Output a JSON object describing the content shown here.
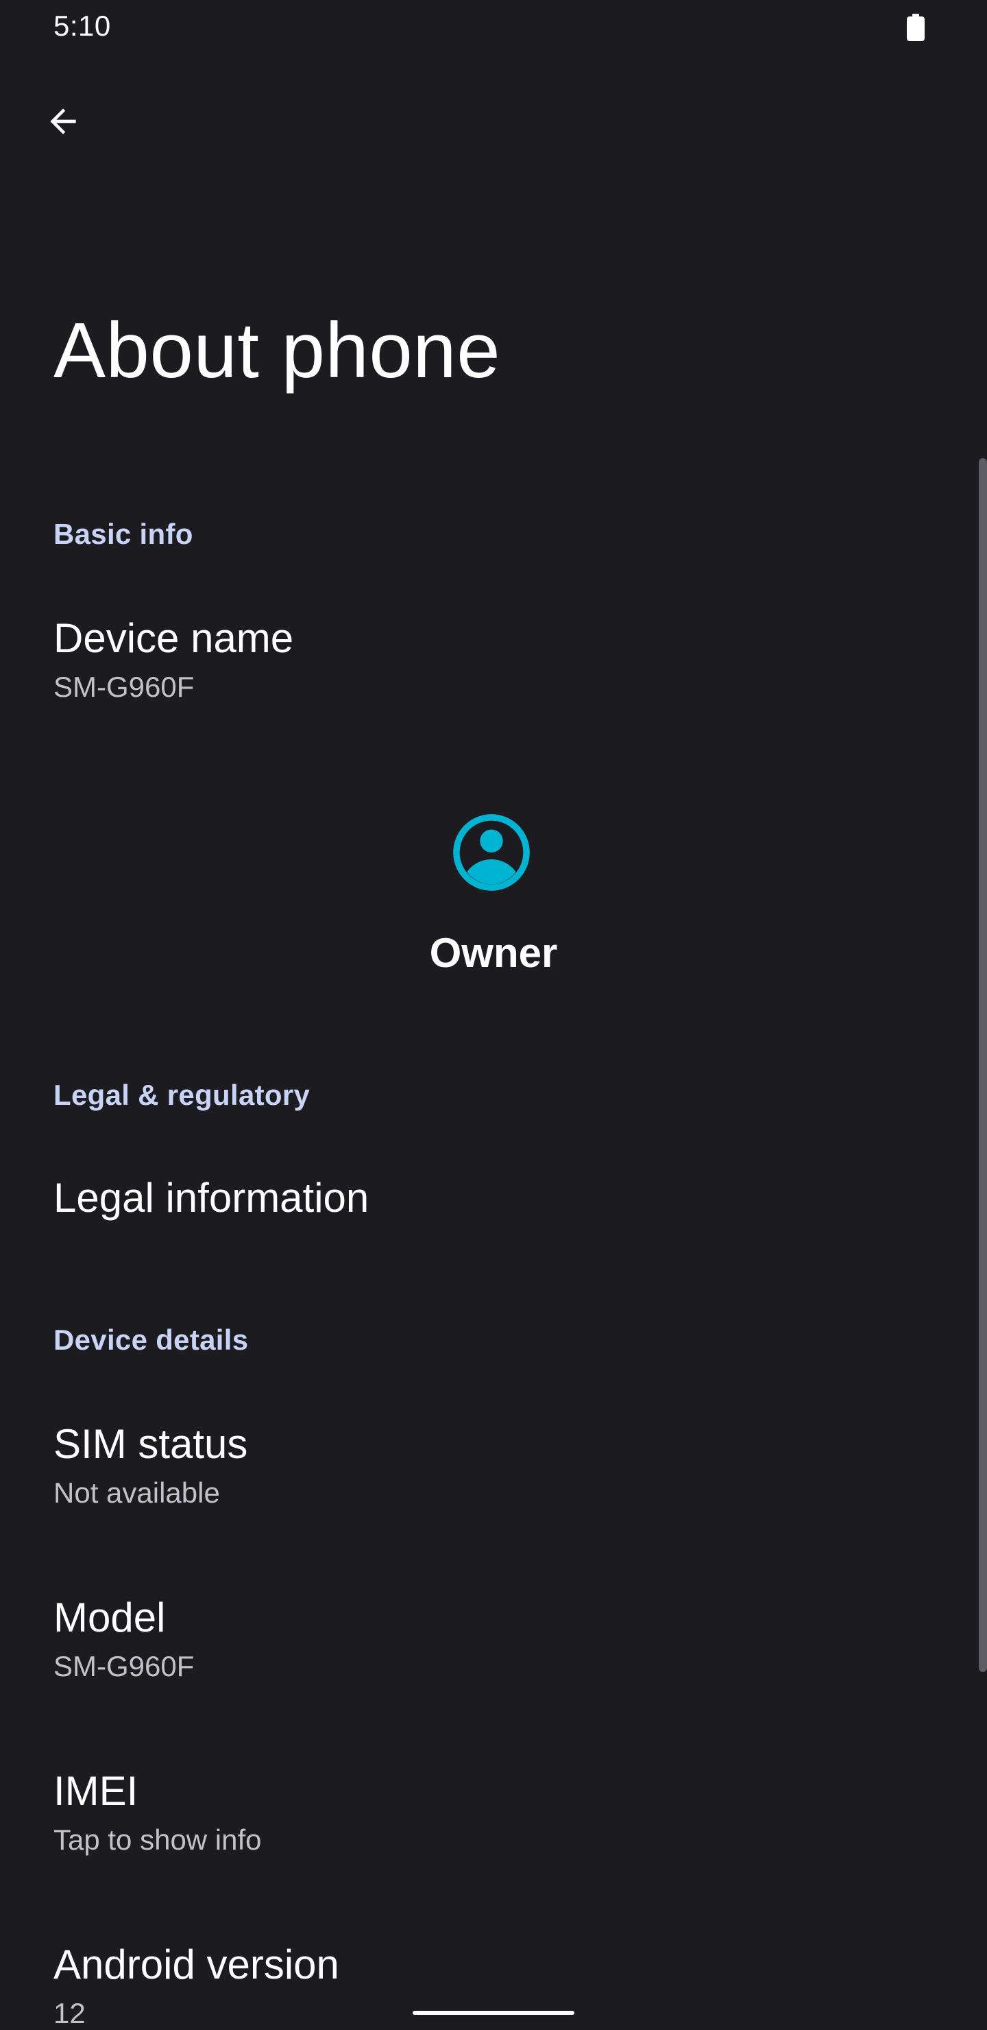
{
  "status_bar": {
    "time": "5:10",
    "battery_icon": "battery-full-icon"
  },
  "toolbar": {
    "back_icon": "arrow-back-icon"
  },
  "page_title": "About phone",
  "sections": {
    "basic_info": {
      "header": "Basic info",
      "device_name": {
        "title": "Device name",
        "summary": "SM-G960F"
      }
    },
    "owner": {
      "icon": "account-circle-icon",
      "name": "Owner",
      "accent_color": "#00b3d1"
    },
    "legal": {
      "header": "Legal & regulatory",
      "legal_information": {
        "title": "Legal information"
      }
    },
    "device_details": {
      "header": "Device details",
      "sim_status": {
        "title": "SIM status",
        "summary": "Not available"
      },
      "model": {
        "title": "Model",
        "summary": "SM-G960F"
      },
      "imei": {
        "title": "IMEI",
        "summary": "Tap to show info"
      },
      "android_version": {
        "title": "Android version",
        "summary": "12"
      }
    }
  },
  "colors": {
    "background": "#1c1b20",
    "section_header": "#c9d3f5",
    "primary_text": "#ffffff",
    "secondary_text": "#c4c2c9"
  }
}
